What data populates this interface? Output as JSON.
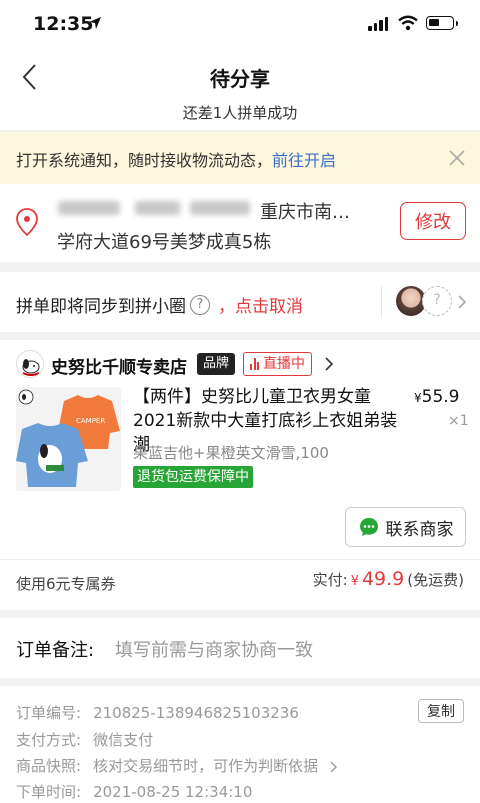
{
  "status": {
    "time": "12:35"
  },
  "nav": {
    "title": "待分享",
    "subtitle": "还差1人拼单成功"
  },
  "notice": {
    "text": "打开系统通知，随时接收物流动态，",
    "link": "前往开启"
  },
  "address": {
    "city": "重庆市南…",
    "street": "学府大道69号美梦成真5栋",
    "edit_label": "修改"
  },
  "sync": {
    "text": "拼单即将同步到拼小圈",
    "help": "?",
    "cancel": "，点击取消",
    "placeholder_avatar": "?"
  },
  "shop": {
    "name": "史努比千顺专卖店",
    "brand_tag": "品牌",
    "live_tag": "直播中"
  },
  "product": {
    "title": "【两件】史努比儿童卫衣男女童2021新款中大童打底衫上衣姐弟装潮",
    "price_symbol": "¥",
    "price": "55.9",
    "qty": "×1",
    "spec": "果蓝吉他+果橙英文滑雪,100",
    "guarantee": "退货包运费保障中",
    "contact_label": "联系商家"
  },
  "summary": {
    "coupon": "使用6元专属券",
    "paid_label": "实付:",
    "currency": "¥",
    "paid_amount": "49.9",
    "shipping": "(免运费)"
  },
  "remark": {
    "label": "订单备注:",
    "placeholder": "填写前需与商家协商一致"
  },
  "order": {
    "no_label": "订单编号:",
    "no_value": "210825-138946825103236",
    "copy_label": "复制",
    "pay_label": "支付方式:",
    "pay_value": "微信支付",
    "snap_label": "商品快照:",
    "snap_value": "核对交易细节时，可作为判断依据",
    "time_label": "下单时间:",
    "time_value": "2021-08-25 12:34:10"
  },
  "colors": {
    "accent_red": "#e4393c",
    "link_blue": "#3b6fc9",
    "guarantee_green": "#27a637",
    "notice_bg": "#fdf7dd"
  }
}
